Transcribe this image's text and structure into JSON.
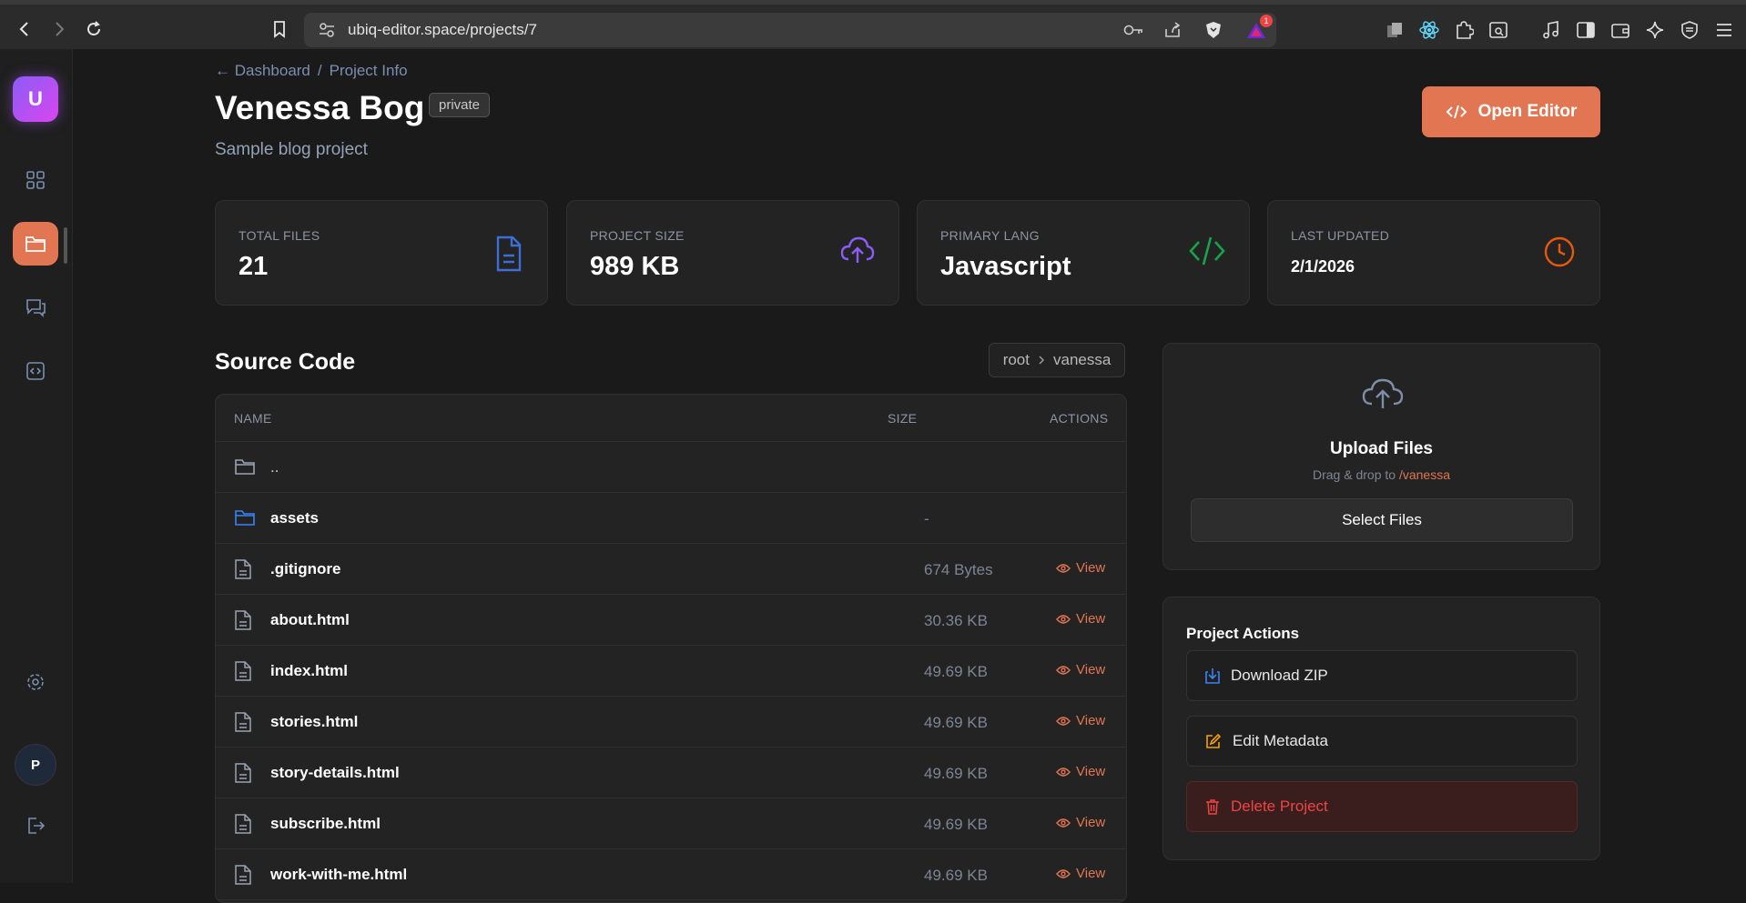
{
  "browser": {
    "url": "ubiq-editor.space/projects/7",
    "notification_count": "1"
  },
  "sidebar": {
    "logo_letter": "U",
    "avatar_letter": "P",
    "items": [
      {
        "icon": "grid-icon"
      },
      {
        "icon": "folder-icon",
        "active": true
      },
      {
        "icon": "chat-icon"
      },
      {
        "icon": "code-box-icon"
      },
      {
        "icon": "gear-icon"
      },
      {
        "icon": "logout-icon"
      }
    ]
  },
  "breadcrumb": {
    "back": "← Dashboard",
    "separator": "/",
    "current": "Project Info"
  },
  "project": {
    "title": "Venessa Bog",
    "visibility": "private",
    "description": "Sample blog project",
    "open_editor_label": "Open Editor"
  },
  "stats": [
    {
      "label": "TOTAL FILES",
      "value": "21",
      "icon": "file-icon",
      "color": "#3b6fd4"
    },
    {
      "label": "PROJECT SIZE",
      "value": "989 KB",
      "icon": "cloud-upload-icon",
      "color": "#8b5cf6"
    },
    {
      "label": "PRIMARY LANG",
      "value": "Javascript",
      "icon": "code-icon",
      "color": "#16a34a"
    },
    {
      "label": "LAST UPDATED",
      "value": "2/1/2026",
      "icon": "clock-icon",
      "color": "#ea580c"
    }
  ],
  "source": {
    "title": "Source Code",
    "path_root": "root",
    "path_current": "vanessa",
    "columns": [
      "NAME",
      "SIZE",
      "ACTIONS"
    ],
    "rows": [
      {
        "name": "..",
        "type": "parent",
        "size": "",
        "action": ""
      },
      {
        "name": "assets",
        "type": "folder",
        "size": "-",
        "action": ""
      },
      {
        "name": ".gitignore",
        "type": "file",
        "size": "674 Bytes",
        "action": "View"
      },
      {
        "name": "about.html",
        "type": "file",
        "size": "30.36 KB",
        "action": "View"
      },
      {
        "name": "index.html",
        "type": "file",
        "size": "49.69 KB",
        "action": "View"
      },
      {
        "name": "stories.html",
        "type": "file",
        "size": "49.69 KB",
        "action": "View"
      },
      {
        "name": "story-details.html",
        "type": "file",
        "size": "49.69 KB",
        "action": "View"
      },
      {
        "name": "subscribe.html",
        "type": "file",
        "size": "49.69 KB",
        "action": "View"
      },
      {
        "name": "work-with-me.html",
        "type": "file",
        "size": "49.69 KB",
        "action": "View"
      }
    ]
  },
  "upload": {
    "title": "Upload Files",
    "hint": "Drag & drop to",
    "hint_path": "/vanessa",
    "button": "Select Files"
  },
  "actions": {
    "title": "Project Actions",
    "download": "Download ZIP",
    "edit": "Edit Metadata",
    "delete": "Delete Project"
  }
}
